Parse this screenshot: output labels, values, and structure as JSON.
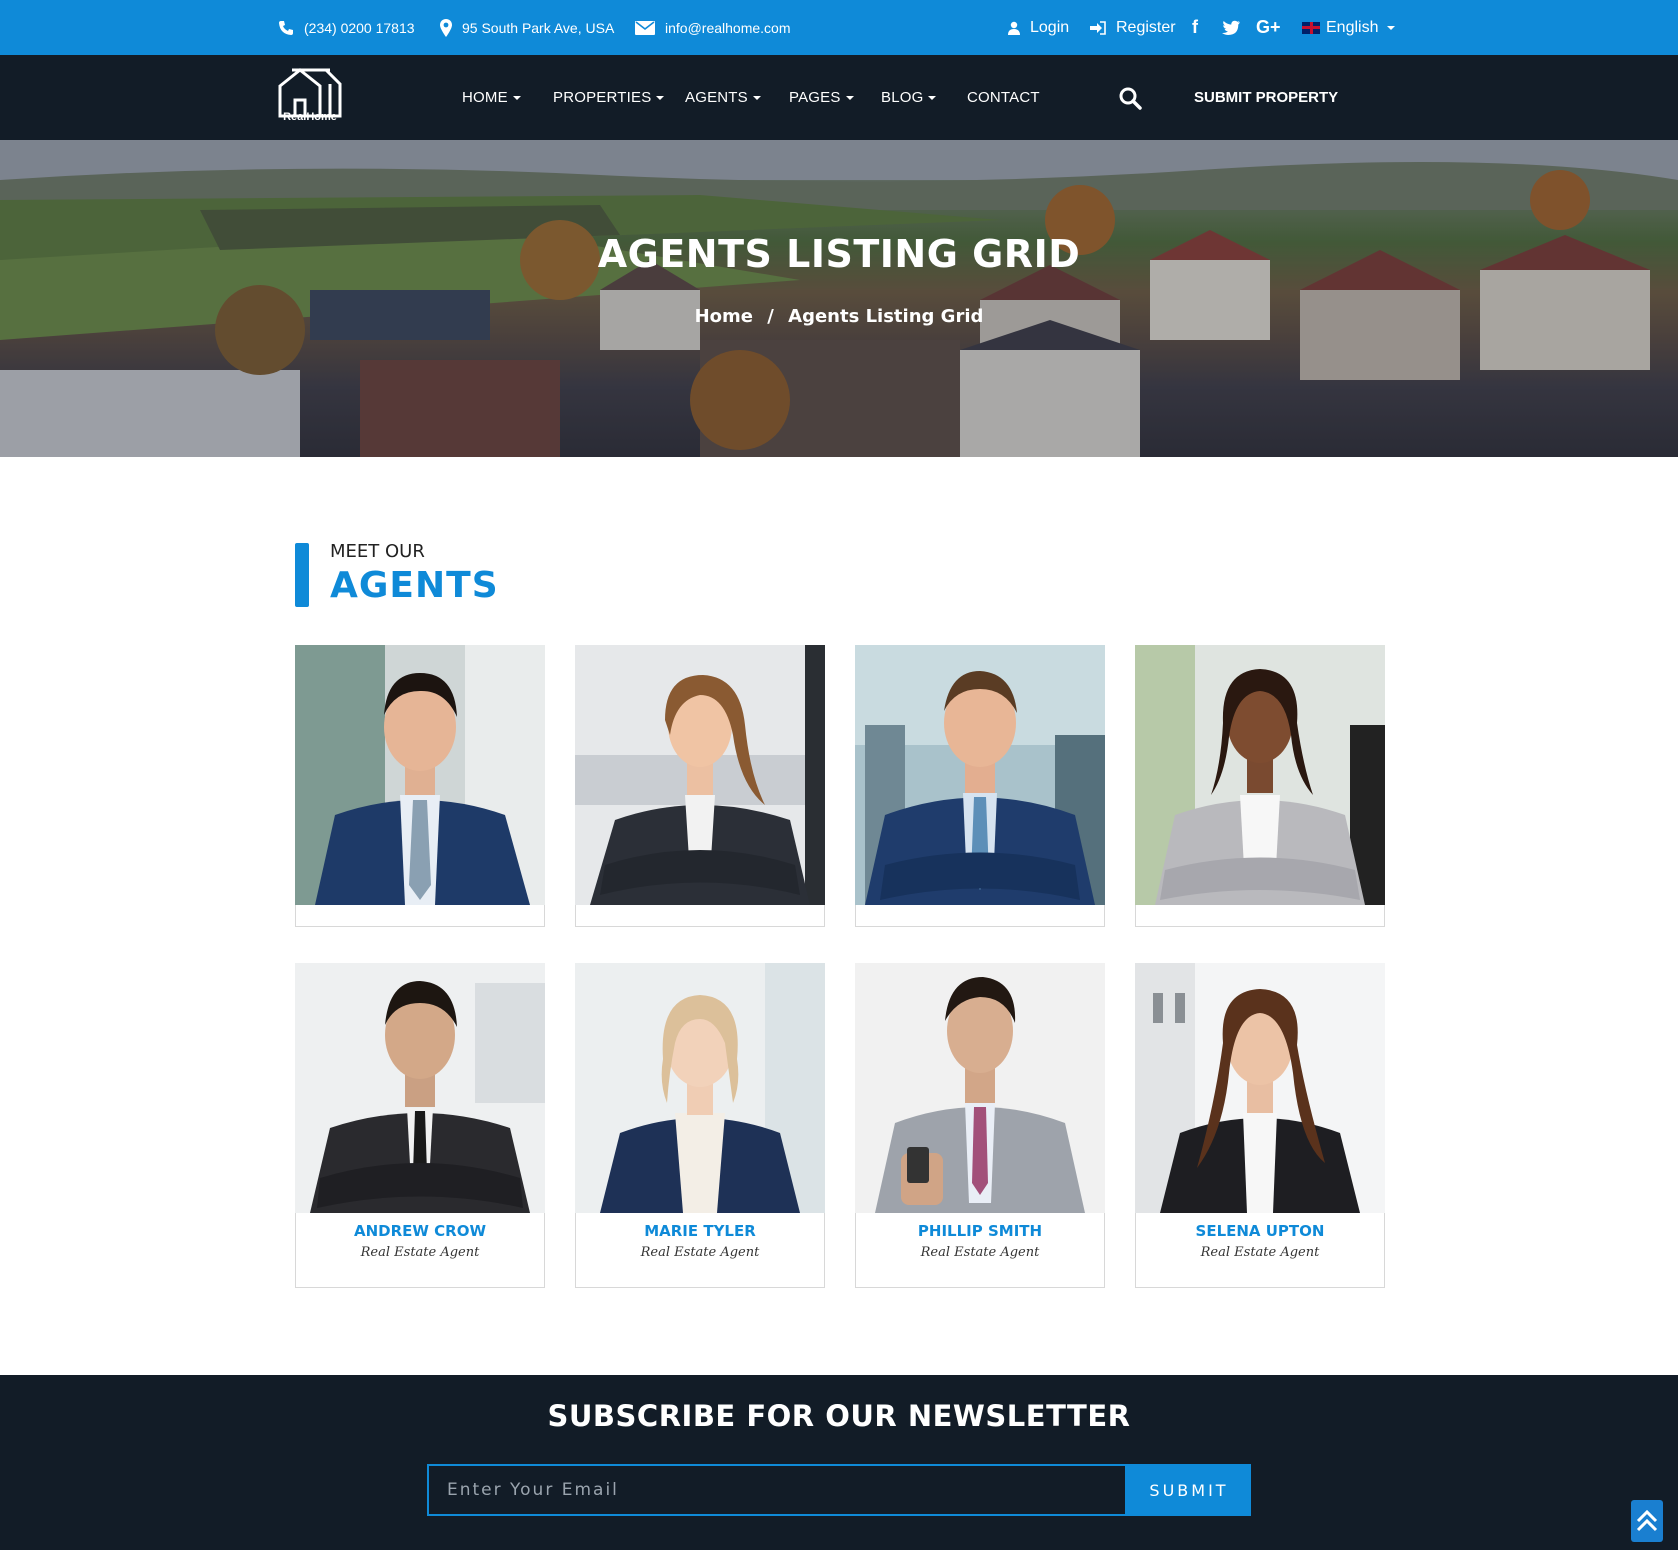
{
  "topbar": {
    "phone": "(234) 0200 17813",
    "address": "95 South Park Ave, USA",
    "email": "info@realhome.com",
    "login": "Login",
    "register": "Register",
    "social": [
      "f",
      "t",
      "G+"
    ],
    "language": "English"
  },
  "nav": {
    "logo_text": "RealHome",
    "items": [
      "HOME",
      "PROPERTIES",
      "AGENTS",
      "PAGES",
      "BLOG",
      "CONTACT"
    ],
    "submit_property": "SUBMIT PROPERTY"
  },
  "hero": {
    "title": "AGENTS LISTING GRID",
    "breadcrumb_home": "Home",
    "breadcrumb_sep": "/",
    "breadcrumb_current": "Agents Listing Grid"
  },
  "section": {
    "subtitle": "MEET OUR",
    "title": "AGENTS"
  },
  "agents": [
    {
      "name": "",
      "role": ""
    },
    {
      "name": "",
      "role": ""
    },
    {
      "name": "",
      "role": ""
    },
    {
      "name": "",
      "role": ""
    },
    {
      "name": "ANDREW CROW",
      "role": "Real Estate Agent"
    },
    {
      "name": "MARIE TYLER",
      "role": "Real Estate Agent"
    },
    {
      "name": "PHILLIP SMITH",
      "role": "Real Estate Agent"
    },
    {
      "name": "SELENA UPTON",
      "role": "Real Estate Agent"
    }
  ],
  "newsletter": {
    "title": "SUBSCRIBE FOR OUR NEWSLETTER",
    "placeholder": "Enter Your Email",
    "button": "SUBMIT"
  },
  "colors": {
    "accent": "#0f8ad8",
    "dark": "#121c27"
  }
}
